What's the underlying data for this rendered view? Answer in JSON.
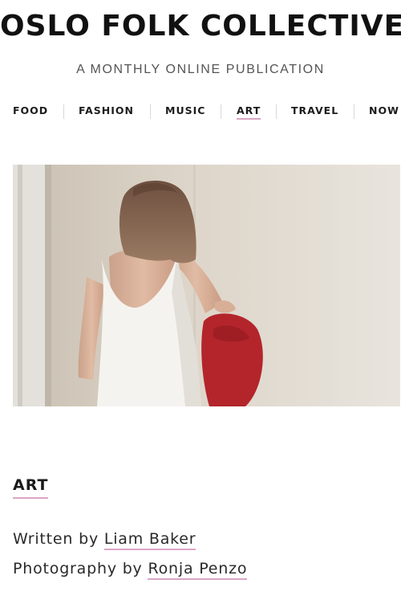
{
  "header": {
    "masthead": "OSLO FOLK COLLECTIVE",
    "tagline": "A MONTHLY ONLINE PUBLICATION"
  },
  "nav": {
    "items": [
      {
        "label": "FOOD"
      },
      {
        "label": "FASHION"
      },
      {
        "label": "MUSIC"
      },
      {
        "label": "ART"
      },
      {
        "label": "TRAVEL"
      },
      {
        "label": "NOW"
      }
    ],
    "active": "ART"
  },
  "article": {
    "section": "ART",
    "written_prefix": "Written by",
    "writer": "Liam Baker",
    "photo_prefix": "Photography by",
    "photographer": "Ronja Penzo"
  },
  "colors": {
    "accent_underline": "#d9a6c6",
    "text": "#222222",
    "muted": "#555555"
  }
}
